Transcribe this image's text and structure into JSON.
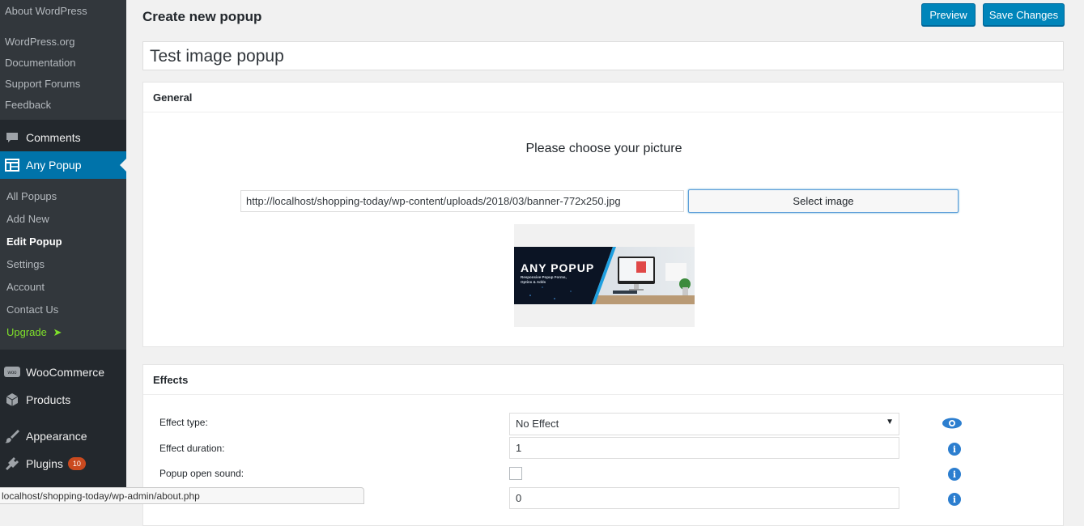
{
  "sidebar": {
    "top_submenu": [
      "About WordPress",
      "WordPress.org",
      "Documentation",
      "Support Forums",
      "Feedback"
    ],
    "comments": "Comments",
    "any_popup": "Any Popup",
    "any_popup_submenu": [
      "All Popups",
      "Add New",
      "Edit Popup",
      "Settings",
      "Account",
      "Contact Us",
      "Upgrade"
    ],
    "woocommerce": "WooCommerce",
    "products": "Products",
    "appearance": "Appearance",
    "plugins": "Plugins",
    "plugins_badge": "10"
  },
  "header": {
    "title": "Create new popup",
    "preview_label": "Preview",
    "save_label": "Save Changes"
  },
  "popup_title": "Test image popup",
  "general": {
    "heading": "General",
    "choose_text": "Please choose your picture",
    "image_url": "http://localhost/shopping-today/wp-content/uploads/2018/03/banner-772x250.jpg",
    "select_label": "Select image",
    "banner_title": "ANY POPUP",
    "banner_subtitle_1": "Responsive Popup Forms,",
    "banner_subtitle_2": "Optins & Adds"
  },
  "effects": {
    "heading": "Effects",
    "effect_type_label": "Effect type:",
    "effect_type_value": "No Effect",
    "effect_duration_label": "Effect duration:",
    "effect_duration_value": "1",
    "open_sound_label": "Popup open sound:",
    "fourth_value": "0"
  },
  "status_bar_url": "localhost/shopping-today/wp-admin/about.php",
  "colors": {
    "accent": "#0073aa",
    "sidebar": "#23282d",
    "upgrade": "#7fe02a",
    "info": "#2c7ecf"
  }
}
